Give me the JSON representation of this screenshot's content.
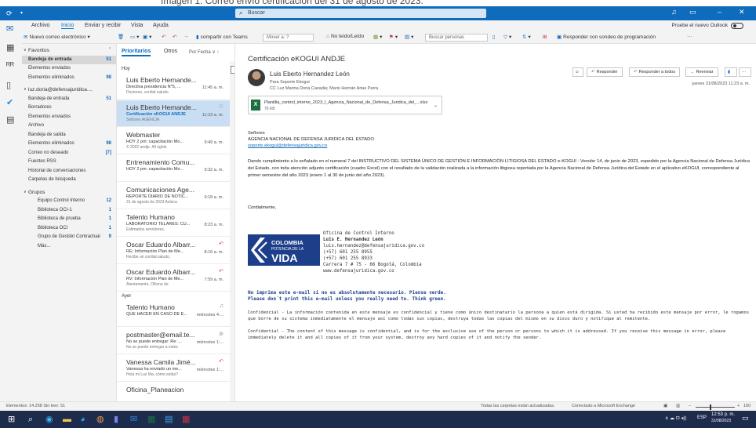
{
  "caption": "Imagen 1. Correo envío certificación del 31 de agosto de 2023.",
  "titlebar": {
    "search_placeholder": "Buscar"
  },
  "menu": {
    "items": [
      "Archivo",
      "Inicio",
      "Enviar y recibir",
      "Vista",
      "Ayuda"
    ],
    "active": "Inicio",
    "try_new": "Pruebe el nuevo Outlook"
  },
  "toolbar": {
    "new_mail": "Nuevo correo electrónico",
    "teams": "compartir con Teams",
    "move": "Mover a: ?",
    "read_unread": "No leído/Leído",
    "search_people": "Buscar personas",
    "schedule_poll": "Responder con sondeo de programación"
  },
  "folders": [
    {
      "label": "Favoritos",
      "type": "head"
    },
    {
      "label": "Bandeja de entrada",
      "count": "51",
      "type": "sel"
    },
    {
      "label": "Elementos enviados",
      "type": "item"
    },
    {
      "label": "Elementos eliminados",
      "count": "98",
      "type": "item"
    },
    {
      "label": "luz.doria@defensajuridica....",
      "type": "head"
    },
    {
      "label": "Bandeja de entrada",
      "count": "51",
      "type": "item"
    },
    {
      "label": "Borradores",
      "type": "item"
    },
    {
      "label": "Elementos enviados",
      "type": "item"
    },
    {
      "label": "Archivo",
      "type": "item"
    },
    {
      "label": "Bandeja de salida",
      "type": "item"
    },
    {
      "label": "Elementos eliminados",
      "count": "98",
      "type": "item"
    },
    {
      "label": "Correo no deseado",
      "count": "[7]",
      "type": "item"
    },
    {
      "label": "Fuentes RSS",
      "type": "item"
    },
    {
      "label": "Historial de conversaciones",
      "type": "item"
    },
    {
      "label": "Carpetas de búsqueda",
      "type": "item"
    },
    {
      "label": "Grupos",
      "type": "head"
    },
    {
      "label": "Equipo Control Interno",
      "count": "12",
      "type": "indent"
    },
    {
      "label": "Biblioteca OCI-1",
      "count": "1",
      "type": "indent"
    },
    {
      "label": "Biblioteca de prueba",
      "count": "1",
      "type": "indent"
    },
    {
      "label": "Biblioteca OCI",
      "count": "1",
      "type": "indent"
    },
    {
      "label": "Grupo de Gestión Contractual",
      "count": "9",
      "type": "indent"
    },
    {
      "label": "Más...",
      "type": "indent"
    }
  ],
  "list": {
    "tab_focused": "Prioritarios",
    "tab_other": "Otros",
    "sort": "Por Fecha ∨ ↑",
    "group_today": "Hoy",
    "group_yesterday": "Ayer",
    "messages": [
      {
        "sender": "Luis Eberto Hernande...",
        "subject": "Directiva presidencia N°5, ...",
        "preview": "Doctores, cordial saludo",
        "time": "11:45 a. m.",
        "selected": false
      },
      {
        "sender": "Luis Eberto Hernande...",
        "subject": "Certificación eKOGUI ANDJE",
        "preview": "Señores   AGENCIA",
        "time": "11:23 a. m.",
        "selected": true
      },
      {
        "sender": "Webmaster",
        "subject": "HOY 2 pm: capacitación Mo...",
        "preview": "© 2022 andje. All rights",
        "time": "9:49 a. m.",
        "selected": false
      },
      {
        "sender": "Entrenamiento Comu...",
        "subject": "HOY 2 pm: capacitación Mo...",
        "preview": "",
        "time": "9:32 a. m.",
        "selected": false
      },
      {
        "sender": "Comunicaciones Age...",
        "subject": "REPORTE DIARIO DE NOTIC...",
        "preview": "31 de agosto de 2023 Azteca",
        "time": "9:18 a. m.",
        "selected": false
      },
      {
        "sender": "Talento Humano",
        "subject": "LABORATORIO TELARES: CU...",
        "preview": "Estimados servidores,",
        "time": "8:23 a. m.",
        "selected": false
      },
      {
        "sender": "Oscar Eduardo Albarr...",
        "subject": "RE: Información Plan de Me...",
        "preview": "Recibe un cordial saludo,",
        "time": "8:16 a. m.",
        "selected": false
      },
      {
        "sender": "Oscar Eduardo Albarr...",
        "subject": "RV: Información Plan de Me...",
        "preview": "Atentamente,   Oficina de",
        "time": "7:59 a. m.",
        "selected": false
      },
      {
        "sender": "Talento Humano",
        "subject": "QUE HACER EN CASO DE E...",
        "preview": "",
        "time": "miércoles 4:...",
        "selected": false
      },
      {
        "sender": "postmaster@email.te...",
        "subject": "No se puede entregar: Re: ...",
        "preview": "No se puede entregar a estos",
        "time": "miércoles 1:...",
        "selected": false
      },
      {
        "sender": "Vanessa Camila Jimé...",
        "subject": "Vanessa ha enviado un me...",
        "preview": "Hola mi Luz Ma, cómo estás?",
        "time": "miércoles 1:...",
        "selected": false
      },
      {
        "sender": "Oficina_Planeacion",
        "subject": "",
        "preview": "",
        "time": "",
        "selected": false
      }
    ]
  },
  "reading": {
    "subject": "Certificación eKOGUI ANDJE",
    "from": "Luis Eberto Hernandez León",
    "to": "Para   Soporte Ekogui",
    "cc": "CC   Luz Marina Doria Cavadia; Mario Hernán Arias Parra",
    "date": "jueves 31/08/2023 11:23 a. m.",
    "reply": "Responder",
    "reply_all": "Responder a todos",
    "forward": "Reenviar",
    "attachment_name": "Plantilla_control_interno_2023_I_Agencia_Nacional_de_Defensa_Juridica_del_...xlsx",
    "attachment_size": "76 KB",
    "salutation": "Señores",
    "agency": "AGENCIA NACIONAL DE DEFENSA JURIDICA DEL ESTADO",
    "email_link": "soporte.ekogui@defensajuridica.gov.co",
    "body": "Dando cumplimiento a lo señalado en el numeral 7 del INSTRUCTIVO DEL SISTEMA ÚNICO DE GESTIÓN E INFORMACIÓN LITIGIOSA DEL ESTADO e-KOGUI - Versión 14, de junio de 2023, expedido por la Agencia Nacional de Defensa Jurídica del Estado, con toda atención adjunto certificación (cuadro Excel) con el resultado de la validación realizada a la información litigiosa reportada por la Agencia Nacional de Defensa Jurídica del Estado en el aplicativo eKOGUI, correspondiente al primer semestre del año 2023 (enero 1 al 30 de junio del año 2023).",
    "closing": "Cordialmente,",
    "logo_line1": "COLOMBIA",
    "logo_line2": "POTENCIA DE LA",
    "logo_line3": "VIDA",
    "sig_office": "Oficina de Control Interno",
    "sig_name": "Luis E. Hernandez León",
    "sig_email": "luis.hernandez@defensajuridica.gov.co",
    "sig_phone1": "(+57) 601 255 8955",
    "sig_phone2": "(+57) 601 255 8933",
    "sig_address": "Carrera 7 # 75 - 66 Bogotá, Colombia",
    "sig_web": "www.defensajuridica.gov.co",
    "green_es": "No imprima este e-mail si no es absolutamente necesario. Piense verde.",
    "green_en": "Please don´t print this e-mail unless you really need to. Think green.",
    "disclaimer_es": "Confidencial - La información contenida en este mensaje es confidencial y tiene como único destinatario la persona a quien está dirigida. Si usted ha recibido este mensaje por error, le rogamos que borre de su sistema inmediatamente el mensaje así como todas sus copias, destruya todas las copias del mismo en su disco duro y notifique al remitente.",
    "disclaimer_en": "Confidential - The content of this message is confidential, and is for the exclusive use of the person or persons to which it is addressed. If you receive this message in error, please immediately delete it and all copies of it from your system, destroy any hard copies of it and notify the sender."
  },
  "status": {
    "left": "Elementos: 14.258   Sin leer: 51",
    "folders_updated": "Todas las carpetas están actualizadas.",
    "connected": "Conectado a Microsoft Exchange",
    "zoom": "100"
  },
  "taskbar": {
    "lang": "ESP",
    "time": "12:53 p. m.",
    "date": "31/08/2023"
  },
  "colors": {
    "accent": "#0f6cbd",
    "selected_row": "#c9def3",
    "rail": "#f3f3f3",
    "taskbar": "#1d2c4c"
  }
}
